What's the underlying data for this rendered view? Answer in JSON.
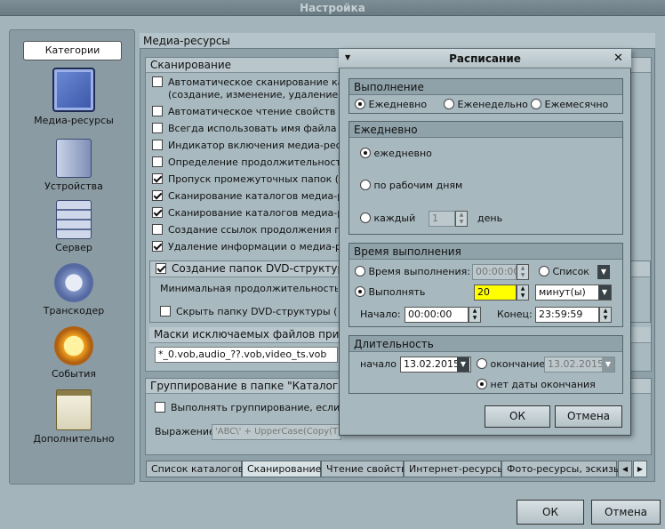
{
  "window": {
    "title": "Настройка"
  },
  "categories": {
    "header": "Категории",
    "items": [
      {
        "label": "Медиа-ресурсы",
        "icon": "media-folder-icon"
      },
      {
        "label": "Устройства",
        "icon": "devices-icon"
      },
      {
        "label": "Сервер",
        "icon": "server-icon"
      },
      {
        "label": "Транскодер",
        "icon": "transcoder-icon"
      },
      {
        "label": "События",
        "icon": "events-icon"
      },
      {
        "label": "Дополнительно",
        "icon": "additional-icon"
      }
    ]
  },
  "panel": {
    "title": "Медиа-ресурсы",
    "scan": {
      "title": "Сканирование",
      "items": [
        {
          "label": "Автоматическое сканирование кат",
          "checked": false
        },
        {
          "label": "(создание, изменение, удаление ф",
          "checked": null
        },
        {
          "label": "Автоматическое чтение свойств ме",
          "checked": false
        },
        {
          "label": "Всегда использовать имя файла в к",
          "checked": false
        },
        {
          "label": "Индикатор включения медиа-ресур",
          "checked": false
        },
        {
          "label": "Определение продолжительности",
          "checked": false
        },
        {
          "label": "Пропуск промежуточных папок  (со",
          "checked": true
        },
        {
          "label": "Сканирование каталогов медиа-ре",
          "checked": true
        },
        {
          "label": "Сканирование каталогов медиа-ре",
          "checked": true
        },
        {
          "label": "Создание ссылок продолжения про",
          "checked": false
        },
        {
          "label": "Удаление информации о медиа-ре",
          "checked": true
        }
      ],
      "dvd_group_label": "Создание папок DVD-структуры",
      "min_duration_label": "Минимальная продолжительность ос",
      "hide_dvd_label": "Скрыть папку DVD-структуры  (по-у",
      "masks_title": "Маски исключаемых файлов при",
      "masks_value": "*_0.vob,audio_??.vob,video_ts.vob"
    },
    "grouping": {
      "title": "Группирование в папке \"Каталоги",
      "do_grouping_label": "Выполнять группирование, если ко",
      "expression_label": "Выражение",
      "expression_value": "'ABC\\' + UpperCase(Copy(T"
    },
    "tabs": [
      "Список каталогов",
      "Сканирование",
      "Чтение свойств",
      "Интернет-ресурсы",
      "Фото-ресурсы, эскизы"
    ],
    "active_tab": 1
  },
  "footer": {
    "ok": "ОК",
    "cancel": "Отмена"
  },
  "dialog": {
    "title": "Расписание",
    "execution": {
      "title": "Выполнение",
      "options": [
        "Ежедневно",
        "Еженедельно",
        "Ежемесячно"
      ],
      "selected": 0
    },
    "daily": {
      "title": "Ежедневно",
      "opt_daily": "ежедневно",
      "opt_workdays": "по рабочим дням",
      "opt_every": "каждый",
      "every_value": "1",
      "every_unit": "день",
      "selected": 0
    },
    "time": {
      "title": "Время выполнения",
      "opt_time": "Время выполнения:",
      "time_value": "00:00:00",
      "opt_list": "Список",
      "opt_run": "Выполнять",
      "run_value": "20",
      "run_unit": "минут(ы)",
      "start_label": "Начало:",
      "start_value": "00:00:00",
      "end_label": "Конец:",
      "end_value": "23:59:59",
      "selected": 1
    },
    "duration": {
      "title": "Длительность",
      "start_label": "начало",
      "start_value": "13.02.2015",
      "end_label": "окончание",
      "end_value": "13.02.2015",
      "no_end_label": "нет даты окончания",
      "selected_no_end": true
    },
    "ok": "ОК",
    "cancel": "Отмена"
  },
  "colors": {
    "highlight": "#ffff00",
    "panel": "#a8b9c0",
    "header": "#b9c7cd"
  }
}
